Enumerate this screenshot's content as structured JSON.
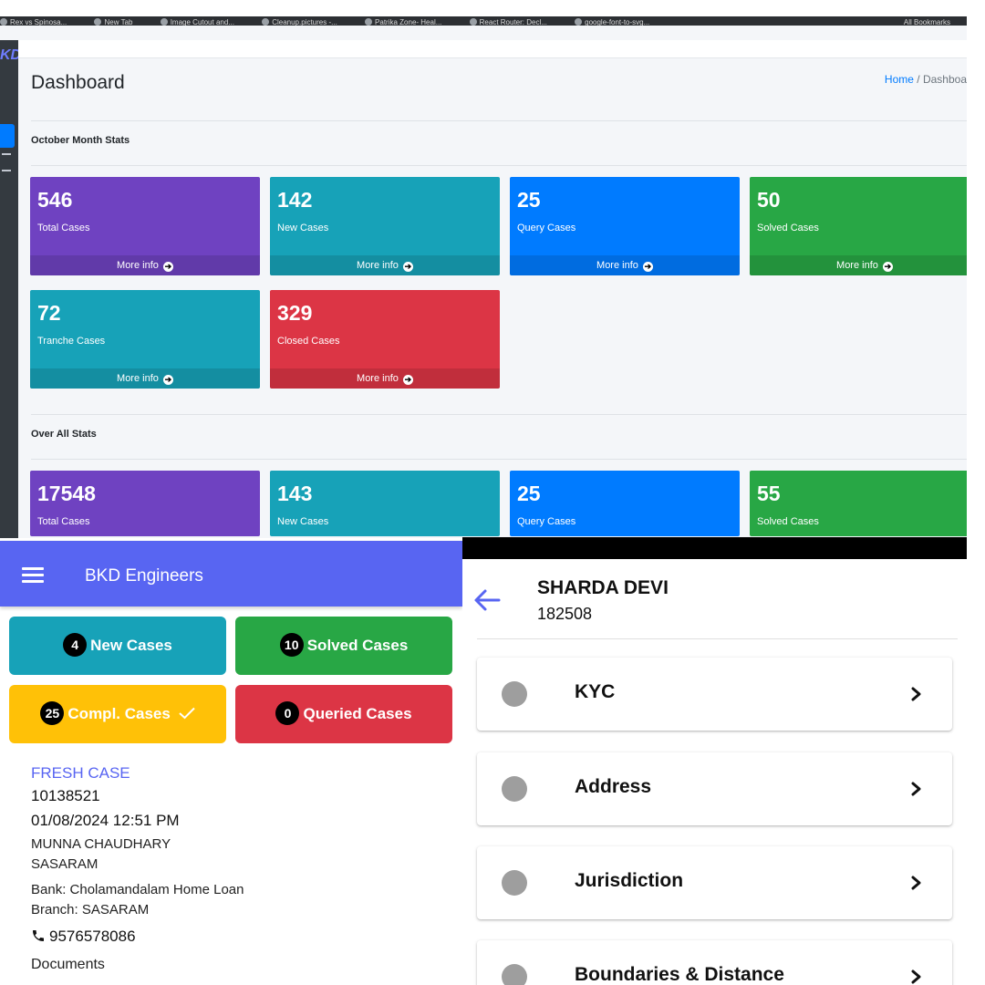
{
  "browser": {
    "bookmarks": [
      "Rex vs Spinosa...",
      "New Tab",
      "Image Cutout and...",
      "Cleanup.pictures -...",
      "Patrika Zone- Heal...",
      "React Router: Decl...",
      "google-font-to-svg..."
    ],
    "right_label": "All Bookmarks"
  },
  "admin": {
    "logo": "KD",
    "page_title": "Dashboard",
    "breadcrumb_home": "Home",
    "breadcrumb_sep": "/",
    "breadcrumb_current": "Dashboa",
    "more_info": "More info",
    "more_info_icon": "arrow-circle-right-icon",
    "month_section": {
      "title": "October Month Stats",
      "boxes": [
        {
          "value": "546",
          "label": "Total Cases",
          "color": "#6f42c1"
        },
        {
          "value": "142",
          "label": "New Cases",
          "color": "#17a2b8"
        },
        {
          "value": "25",
          "label": "Query Cases",
          "color": "#007bff"
        },
        {
          "value": "50",
          "label": "Solved Cases",
          "color": "#28a745"
        },
        {
          "value": "72",
          "label": "Tranche Cases",
          "color": "#17a2b8"
        },
        {
          "value": "329",
          "label": "Closed Cases",
          "color": "#dc3545"
        }
      ]
    },
    "overall_section": {
      "title": "Over All Stats",
      "boxes": [
        {
          "value": "17548",
          "label": "Total Cases",
          "color": "#6f42c1"
        },
        {
          "value": "143",
          "label": "New Cases",
          "color": "#17a2b8"
        },
        {
          "value": "25",
          "label": "Query Cases",
          "color": "#007bff"
        },
        {
          "value": "55",
          "label": "Solved Cases",
          "color": "#28a745"
        }
      ]
    }
  },
  "mobile_list": {
    "app_title": "BKD Engineers",
    "chips": {
      "new": {
        "count": "4",
        "label": "New Cases"
      },
      "solved": {
        "count": "10",
        "label": "Solved Cases"
      },
      "completed": {
        "count": "25",
        "label": "Compl. Cases",
        "icon": "checkmark-icon"
      },
      "queried": {
        "count": "0",
        "label": "Queried Cases"
      }
    },
    "case": {
      "type": "FRESH CASE",
      "number": "10138521",
      "datetime": "01/08/2024 12:51 PM",
      "name": "MUNNA CHAUDHARY",
      "place": "SASARAM",
      "bank": "Bank: Cholamandalam Home Loan",
      "branch": "Branch: SASARAM",
      "phone": "9576578086",
      "documents": "Documents"
    }
  },
  "mobile_detail": {
    "name": "SHARDA DEVI",
    "id": "182508",
    "sections": [
      "KYC",
      "Address",
      "Jurisdiction",
      "Boundaries & Distance"
    ]
  }
}
